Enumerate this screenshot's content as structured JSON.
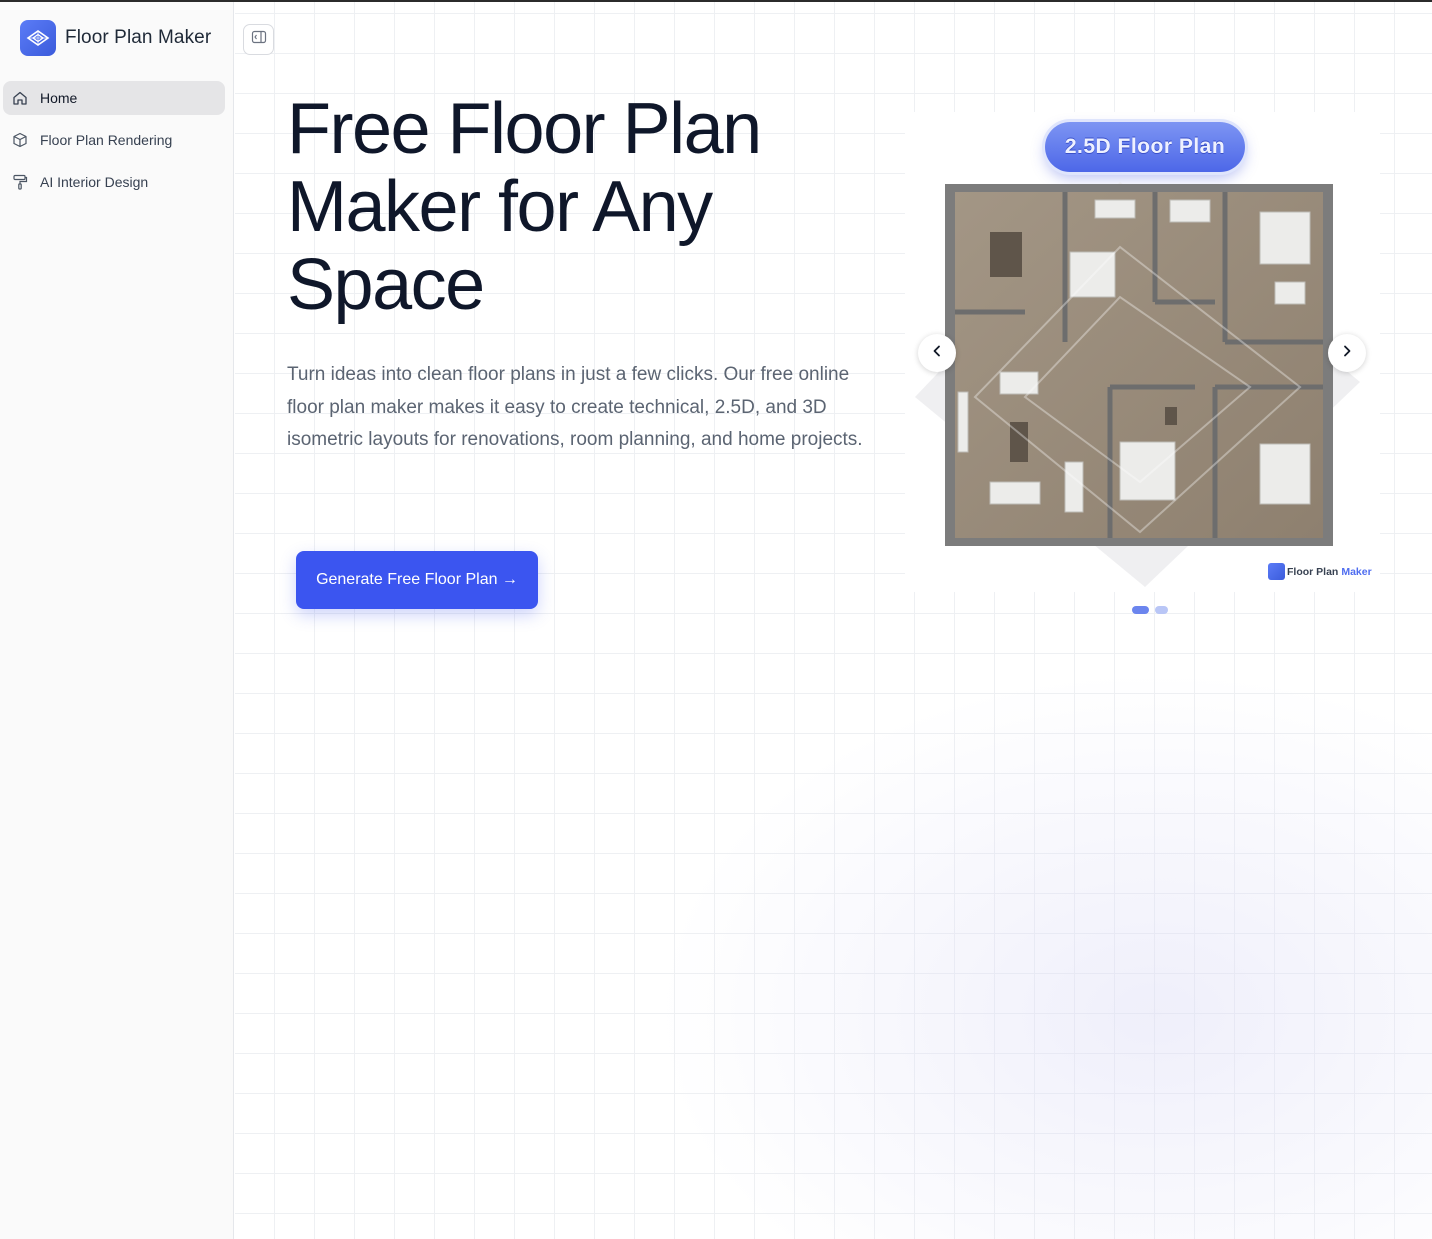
{
  "sidebar": {
    "brand": {
      "name": "Floor Plan Maker",
      "icon": "logo-icon"
    },
    "items": [
      {
        "label": "Home",
        "icon": "home-icon",
        "active": true
      },
      {
        "label": "Floor Plan Rendering",
        "icon": "cube-icon",
        "active": false
      },
      {
        "label": "AI Interior Design",
        "icon": "paint-roller-icon",
        "active": false
      }
    ]
  },
  "main": {
    "toggle_icon": "sidebar-toggle-icon",
    "hero": {
      "title": "Free Floor Plan Maker for Any Space",
      "description": "Turn ideas into clean floor plans in just a few clicks. Our free online floor plan maker makes it easy to create technical, 2.5D, and 3D isometric layouts for renovations, room planning, and home projects.",
      "cta_label": "Generate Free Floor Plan →"
    },
    "carousel": {
      "slide_badge": "2.5D Floor Plan",
      "watermark_brand": "Floor Plan",
      "watermark_accent": "Maker",
      "prev_icon": "chevron-left-icon",
      "next_icon": "chevron-right-icon",
      "slide_count": 2,
      "active_slide": 1
    }
  },
  "colors": {
    "accent": "#3b55f0",
    "sidebar_bg": "#fafafa",
    "active_nav_bg": "#e5e5e7",
    "title": "#0f172a",
    "body_text": "#5b6472"
  }
}
